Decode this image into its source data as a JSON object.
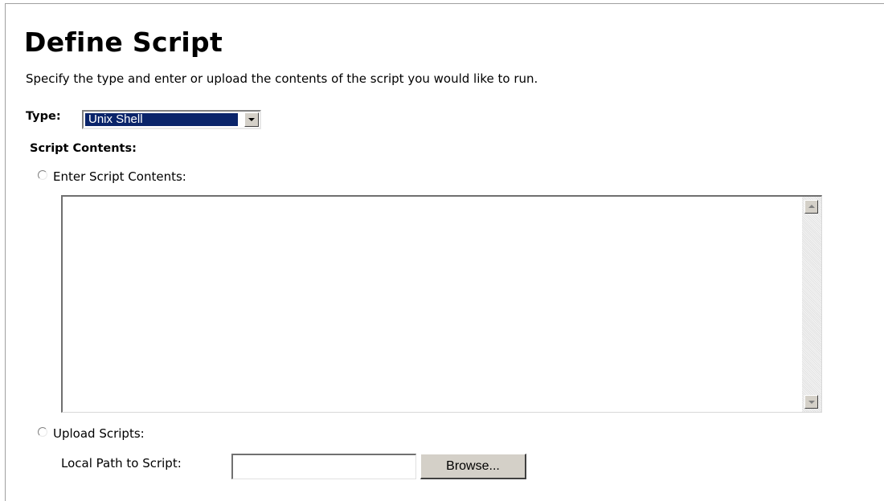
{
  "header": {
    "title": "Define Script",
    "description": "Specify the type and enter or upload the contents of the script you would like to run."
  },
  "type_field": {
    "label": "Type:",
    "selected": "Unix Shell",
    "highlight_color": "#0a246a"
  },
  "script_contents": {
    "label": "Script Contents:",
    "enter_option_label": "Enter Script Contents:",
    "textarea_value": "",
    "upload_option_label": "Upload Scripts:",
    "local_path_label": "Local Path to Script:",
    "local_path_value": "",
    "browse_label": "Browse..."
  },
  "icons": {
    "select_arrow": "chevron-down-icon",
    "scroll_up": "scroll-up-arrow-icon",
    "scroll_down": "scroll-down-arrow-icon"
  }
}
